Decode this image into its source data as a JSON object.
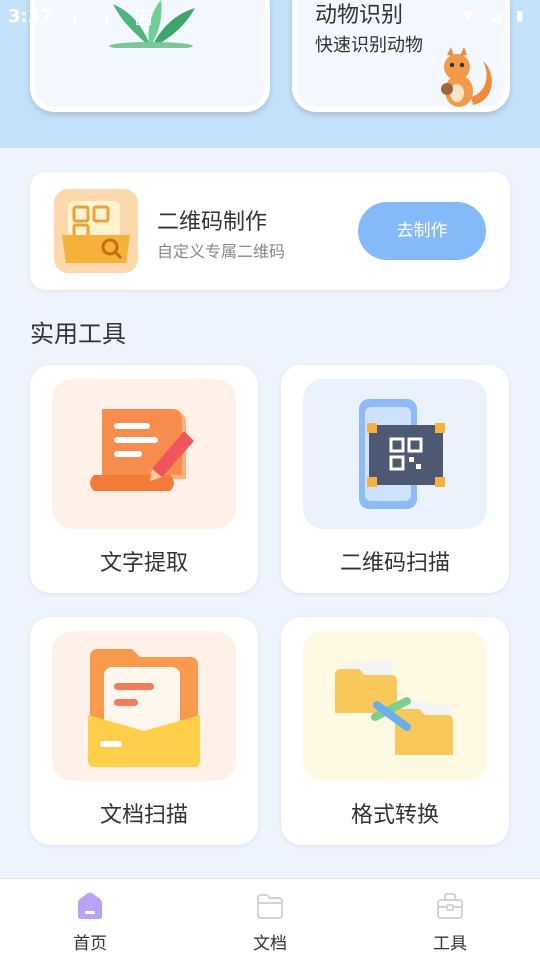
{
  "status_bar": {
    "time": "3:37"
  },
  "hero_cards": {
    "animal_title": "动物识别",
    "animal_subtitle": "快速识别动物"
  },
  "qr_card": {
    "title": "二维码制作",
    "subtitle": "自定义专属二维码",
    "button_label": "去制作"
  },
  "section_title": "实用工具",
  "tools": [
    {
      "label": "文字提取",
      "icon": "scroll-pen-icon",
      "bg": "#fff1e8"
    },
    {
      "label": "二维码扫描",
      "icon": "phone-qr-scan-icon",
      "bg": "#eaf2fe"
    },
    {
      "label": "文档扫描",
      "icon": "folder-document-icon",
      "bg": "#fff1e8"
    },
    {
      "label": "格式转换",
      "icon": "folder-convert-icon",
      "bg": "#fdf9e3"
    }
  ],
  "tab_bar": {
    "items": [
      {
        "label": "首页",
        "icon": "home-icon",
        "active": true
      },
      {
        "label": "文档",
        "icon": "folder-icon",
        "active": false
      },
      {
        "label": "工具",
        "icon": "toolbox-icon",
        "active": false
      }
    ]
  },
  "colors": {
    "accent": "#85bafa",
    "active_tab_icon": "#b9a3f5",
    "inactive_tab_icon": "#d3d3d3",
    "top_band": "#c4e1fb"
  }
}
